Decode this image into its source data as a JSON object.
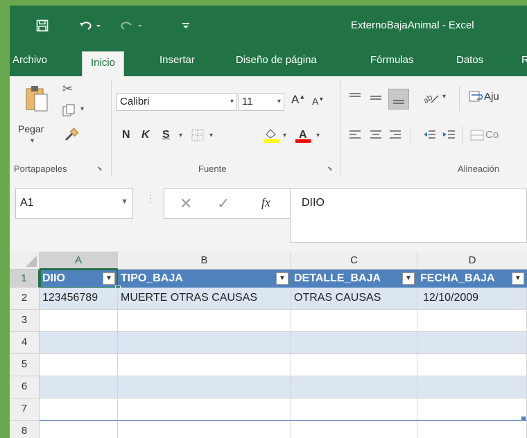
{
  "app": {
    "window_title": "ExternoBajaAnimal - Excel"
  },
  "tabs": [
    {
      "label": "Archivo"
    },
    {
      "label": "Inicio"
    },
    {
      "label": "Insertar"
    },
    {
      "label": "Diseño de página"
    },
    {
      "label": "Fórmulas"
    },
    {
      "label": "Datos"
    },
    {
      "label": "R"
    }
  ],
  "ribbon": {
    "clipboard": {
      "paste_label": "Pegar",
      "group_label": "Portapapeles"
    },
    "font": {
      "family": "Calibri",
      "size": "11",
      "bold": "N",
      "italic": "K",
      "underline": "S",
      "group_label": "Fuente",
      "highlight_color": "#ffff00",
      "font_color": "#ff0000"
    },
    "alignment": {
      "wrap_label": "Aju",
      "merge_label": "Co",
      "group_label": "Alineación"
    }
  },
  "formula_bar": {
    "name_box": "A1",
    "fx": "fx",
    "value": "DIIO"
  },
  "sheet": {
    "columns": [
      "A",
      "B",
      "C",
      "D"
    ],
    "rows": [
      "1",
      "2",
      "3",
      "4",
      "5",
      "6",
      "7",
      "8"
    ],
    "header_row": [
      "DIIO",
      "TIPO_BAJA",
      "DETALLE_BAJA",
      "FECHA_BAJA"
    ],
    "data_rows": [
      [
        "123456789",
        "MUERTE OTRAS CAUSAS",
        "OTRAS CAUSAS",
        "12/10/2009"
      ]
    ],
    "table_header_color": "#4f81bd",
    "table_band_color": "#dce6f1",
    "selection_color": "#217346"
  }
}
